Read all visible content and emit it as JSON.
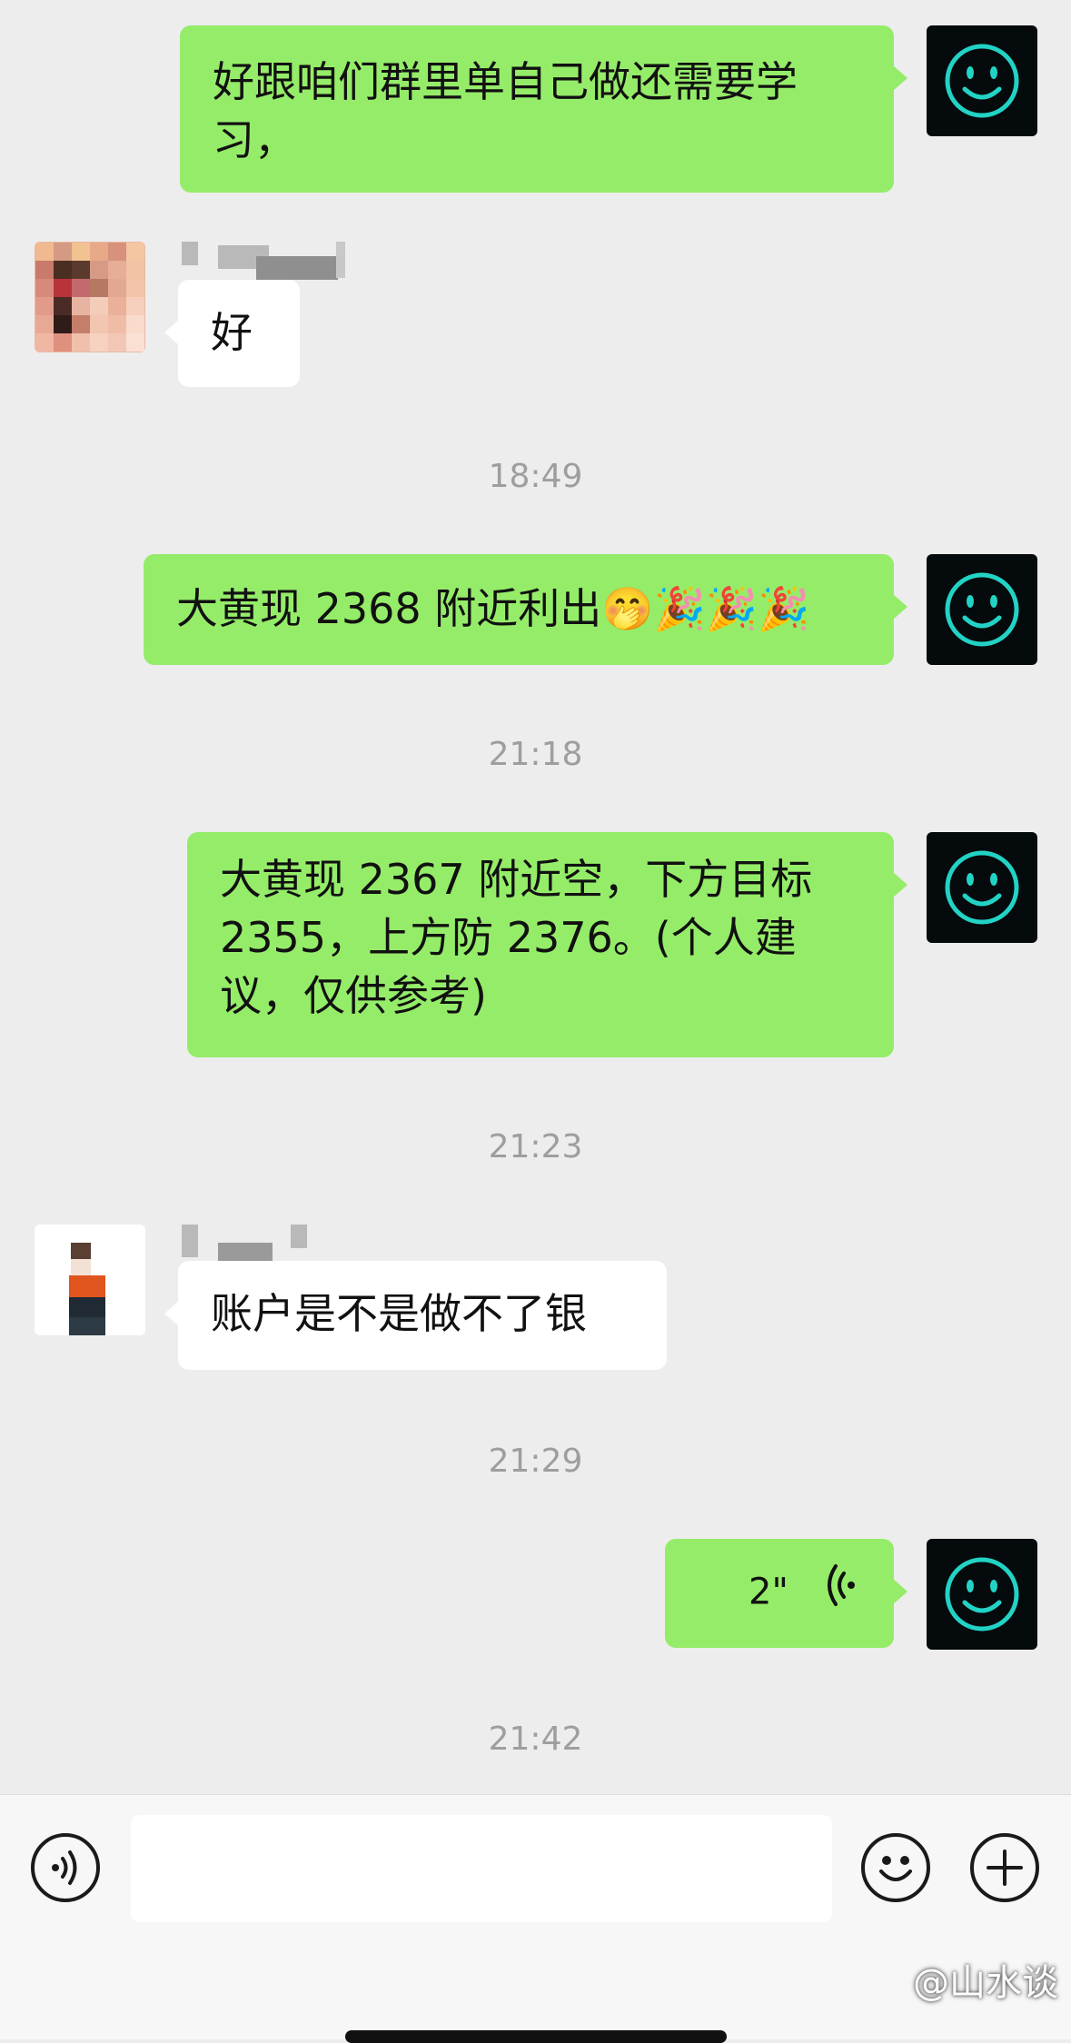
{
  "messages": {
    "m1_text": "好跟咱们群里单自己做还需要学习，",
    "m2_text": "好",
    "m3_text": "大黄现 2368 附近利出🤭🎉🎉🎉",
    "m4_text": "大黄现 2367 附近空，下方目标 2355，上方防 2376。(个人建议，仅供参考)",
    "m5_text": "账户是不是做不了银",
    "m6_duration": "2\""
  },
  "timestamps": {
    "t1": "18:49",
    "t2": "21:18",
    "t3": "21:23",
    "t4": "21:29",
    "t5": "21:42"
  },
  "input_bar": {
    "voice_icon": "voice-input-icon",
    "emoji_icon": "emoji-icon",
    "plus_icon": "plus-icon"
  },
  "watermark": "@山水谈",
  "colors": {
    "my_bubble": "#95ec69",
    "their_bubble": "#ffffff",
    "background": "#ededed",
    "avatar_glow": "#22d3c5"
  }
}
